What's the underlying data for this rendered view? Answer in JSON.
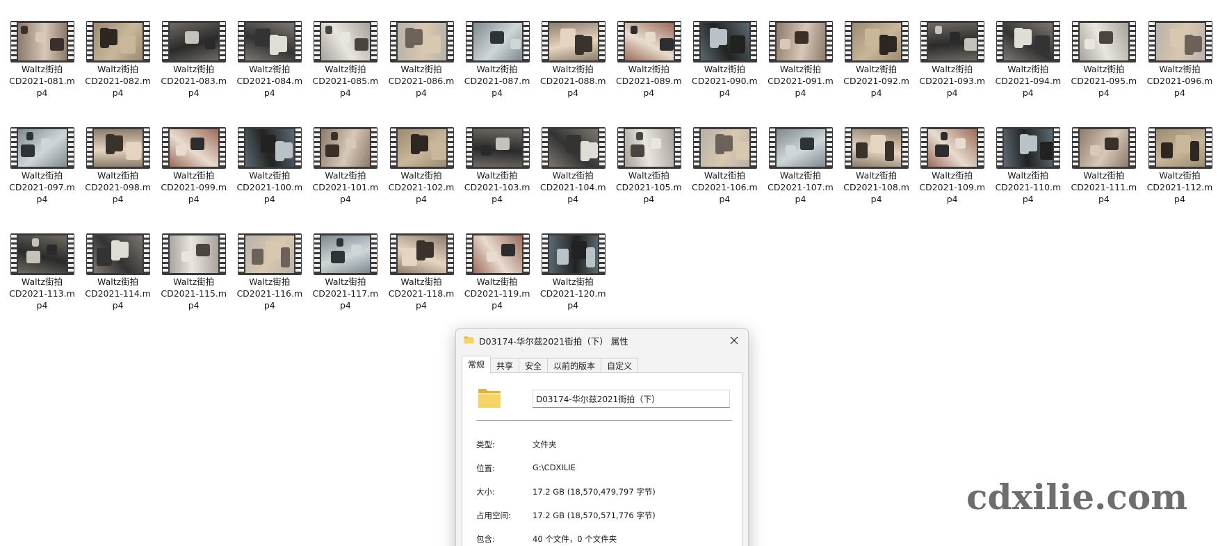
{
  "files": [
    {
      "line1": "Waltz街拍",
      "line2": "CD2021-081.m",
      "line3": "p4"
    },
    {
      "line1": "Waltz街拍",
      "line2": "CD2021-082.m",
      "line3": "p4"
    },
    {
      "line1": "Waltz街拍",
      "line2": "CD2021-083.m",
      "line3": "p4"
    },
    {
      "line1": "Waltz街拍",
      "line2": "CD2021-084.m",
      "line3": "p4"
    },
    {
      "line1": "Waltz街拍",
      "line2": "CD2021-085.m",
      "line3": "p4"
    },
    {
      "line1": "Waltz街拍",
      "line2": "CD2021-086.m",
      "line3": "p4"
    },
    {
      "line1": "Waltz街拍",
      "line2": "CD2021-087.m",
      "line3": "p4"
    },
    {
      "line1": "Waltz街拍",
      "line2": "CD2021-088.m",
      "line3": "p4"
    },
    {
      "line1": "Waltz街拍",
      "line2": "CD2021-089.m",
      "line3": "p4"
    },
    {
      "line1": "Waltz街拍",
      "line2": "CD2021-090.m",
      "line3": "p4"
    },
    {
      "line1": "Waltz街拍",
      "line2": "CD2021-091.m",
      "line3": "p4"
    },
    {
      "line1": "Waltz街拍",
      "line2": "CD2021-092.m",
      "line3": "p4"
    },
    {
      "line1": "Waltz街拍",
      "line2": "CD2021-093.m",
      "line3": "p4"
    },
    {
      "line1": "Waltz街拍",
      "line2": "CD2021-094.m",
      "line3": "p4"
    },
    {
      "line1": "Waltz街拍",
      "line2": "CD2021-095.m",
      "line3": "p4"
    },
    {
      "line1": "Waltz街拍",
      "line2": "CD2021-096.m",
      "line3": "p4"
    },
    {
      "line1": "Waltz街拍",
      "line2": "CD2021-097.m",
      "line3": "p4"
    },
    {
      "line1": "Waltz街拍",
      "line2": "CD2021-098.m",
      "line3": "p4"
    },
    {
      "line1": "Waltz街拍",
      "line2": "CD2021-099.m",
      "line3": "p4"
    },
    {
      "line1": "Waltz街拍",
      "line2": "CD2021-100.m",
      "line3": "p4"
    },
    {
      "line1": "Waltz街拍",
      "line2": "CD2021-101.m",
      "line3": "p4"
    },
    {
      "line1": "Waltz街拍",
      "line2": "CD2021-102.m",
      "line3": "p4"
    },
    {
      "line1": "Waltz街拍",
      "line2": "CD2021-103.m",
      "line3": "p4"
    },
    {
      "line1": "Waltz街拍",
      "line2": "CD2021-104.m",
      "line3": "p4"
    },
    {
      "line1": "Waltz街拍",
      "line2": "CD2021-105.m",
      "line3": "p4"
    },
    {
      "line1": "Waltz街拍",
      "line2": "CD2021-106.m",
      "line3": "p4"
    },
    {
      "line1": "Waltz街拍",
      "line2": "CD2021-107.m",
      "line3": "p4"
    },
    {
      "line1": "Waltz街拍",
      "line2": "CD2021-108.m",
      "line3": "p4"
    },
    {
      "line1": "Waltz街拍",
      "line2": "CD2021-109.m",
      "line3": "p4"
    },
    {
      "line1": "Waltz街拍",
      "line2": "CD2021-110.m",
      "line3": "p4"
    },
    {
      "line1": "Waltz街拍",
      "line2": "CD2021-111.m",
      "line3": "p4"
    },
    {
      "line1": "Waltz街拍",
      "line2": "CD2021-112.m",
      "line3": "p4"
    },
    {
      "line1": "Waltz街拍",
      "line2": "CD2021-113.m",
      "line3": "p4"
    },
    {
      "line1": "Waltz街拍",
      "line2": "CD2021-114.m",
      "line3": "p4"
    },
    {
      "line1": "Waltz街拍",
      "line2": "CD2021-115.m",
      "line3": "p4"
    },
    {
      "line1": "Waltz街拍",
      "line2": "CD2021-116.m",
      "line3": "p4"
    },
    {
      "line1": "Waltz街拍",
      "line2": "CD2021-117.m",
      "line3": "p4"
    },
    {
      "line1": "Waltz街拍",
      "line2": "CD2021-118.m",
      "line3": "p4"
    },
    {
      "line1": "Waltz街拍",
      "line2": "CD2021-119.m",
      "line3": "p4"
    },
    {
      "line1": "Waltz街拍",
      "line2": "CD2021-120.m",
      "line3": "p4"
    }
  ],
  "thumbnail_icon": "video-file-icon",
  "dialog": {
    "title": "D03174-华尔兹2021街拍（下） 属性",
    "title_icon": "folder-icon",
    "close_icon": "close-icon",
    "tabs": [
      {
        "label": "常规",
        "active": true
      },
      {
        "label": "共享",
        "active": false
      },
      {
        "label": "安全",
        "active": false
      },
      {
        "label": "以前的版本",
        "active": false
      },
      {
        "label": "自定义",
        "active": false
      }
    ],
    "folder_name": "D03174-华尔兹2021街拍（下）",
    "properties": [
      {
        "label": "类型:",
        "value": "文件夹"
      },
      {
        "label": "位置:",
        "value": "G:\\CDXILIE"
      },
      {
        "label": "大小:",
        "value": "17.2 GB (18,570,479,797 字节)"
      },
      {
        "label": "占用空间:",
        "value": "17.2 GB (18,570,571,776 字节)"
      },
      {
        "label": "包含:",
        "value": "40 个文件，0 个文件夹"
      }
    ]
  },
  "watermark": "cdxilie.com",
  "colors": {
    "folder_yellow": "#f6d365",
    "folder_dark": "#e2b33c",
    "dialog_bg": "#f3f3f3"
  }
}
